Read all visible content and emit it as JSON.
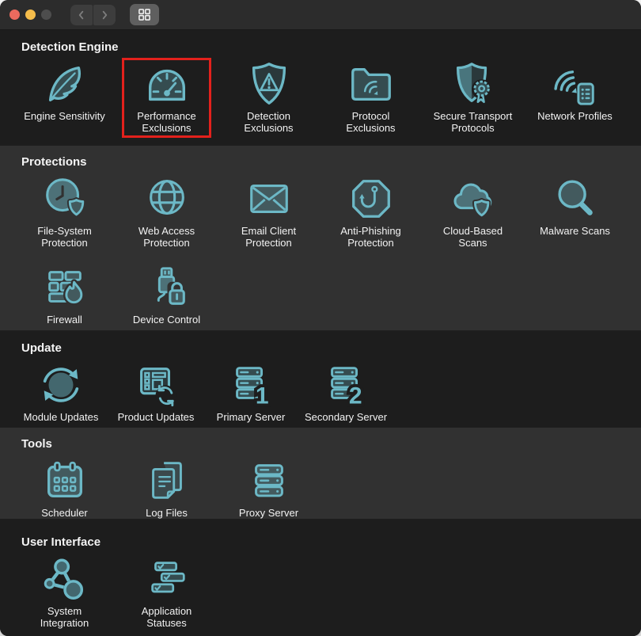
{
  "colors": {
    "accent_teal": "#6cb8c6",
    "highlight_red": "#e3211c",
    "traffic_close": "#ec6a5e",
    "traffic_minimize": "#f5bd4b",
    "traffic_zoom_disabled": "#4d4d4d"
  },
  "titlebar": {
    "back_icon": "chevron-left",
    "forward_icon": "chevron-right",
    "view_toggle_icon": "grid"
  },
  "sections": [
    {
      "title": "Detection Engine",
      "rows": [
        [
          {
            "label": "Engine Sensitivity",
            "icon": "feather"
          },
          {
            "label": "Performance\nExclusions",
            "icon": "gauge",
            "highlighted": true
          },
          {
            "label": "Detection\nExclusions",
            "icon": "shield-alert"
          },
          {
            "label": "Protocol\nExclusions",
            "icon": "folder-wifi"
          },
          {
            "label": "Secure Transport\nProtocols",
            "icon": "shield-badge"
          },
          {
            "label": "Network Profiles",
            "icon": "wifi-device"
          }
        ]
      ]
    },
    {
      "title": "Protections",
      "rows": [
        [
          {
            "label": "File-System\nProtection",
            "icon": "clock-shield"
          },
          {
            "label": "Web Access\nProtection",
            "icon": "globe"
          },
          {
            "label": "Email Client\nProtection",
            "icon": "envelope"
          },
          {
            "label": "Anti-Phishing\nProtection",
            "icon": "octagon-hook"
          },
          {
            "label": "Cloud-Based\nScans",
            "icon": "cloud-shield"
          },
          {
            "label": "Malware Scans",
            "icon": "magnifier"
          }
        ],
        [
          {
            "label": "Firewall",
            "icon": "bricks-flame"
          },
          {
            "label": "Device Control",
            "icon": "usb-lock"
          }
        ]
      ]
    },
    {
      "title": "Update",
      "rows": [
        [
          {
            "label": "Module Updates",
            "icon": "sync-circle"
          },
          {
            "label": "Product Updates",
            "icon": "panel-sync"
          },
          {
            "label": "Primary Server",
            "icon": "server-one"
          },
          {
            "label": "Secondary Server",
            "icon": "server-two"
          }
        ]
      ]
    },
    {
      "title": "Tools",
      "rows": [
        [
          {
            "label": "Scheduler",
            "icon": "calendar"
          },
          {
            "label": "Log Files",
            "icon": "documents"
          },
          {
            "label": "Proxy Server",
            "icon": "server-stack"
          }
        ]
      ]
    },
    {
      "title": "User Interface",
      "rows": [
        [
          {
            "label": "System\nIntegration",
            "icon": "network-nodes"
          },
          {
            "label": "Application\nStatuses",
            "icon": "status-bars"
          }
        ]
      ]
    }
  ]
}
